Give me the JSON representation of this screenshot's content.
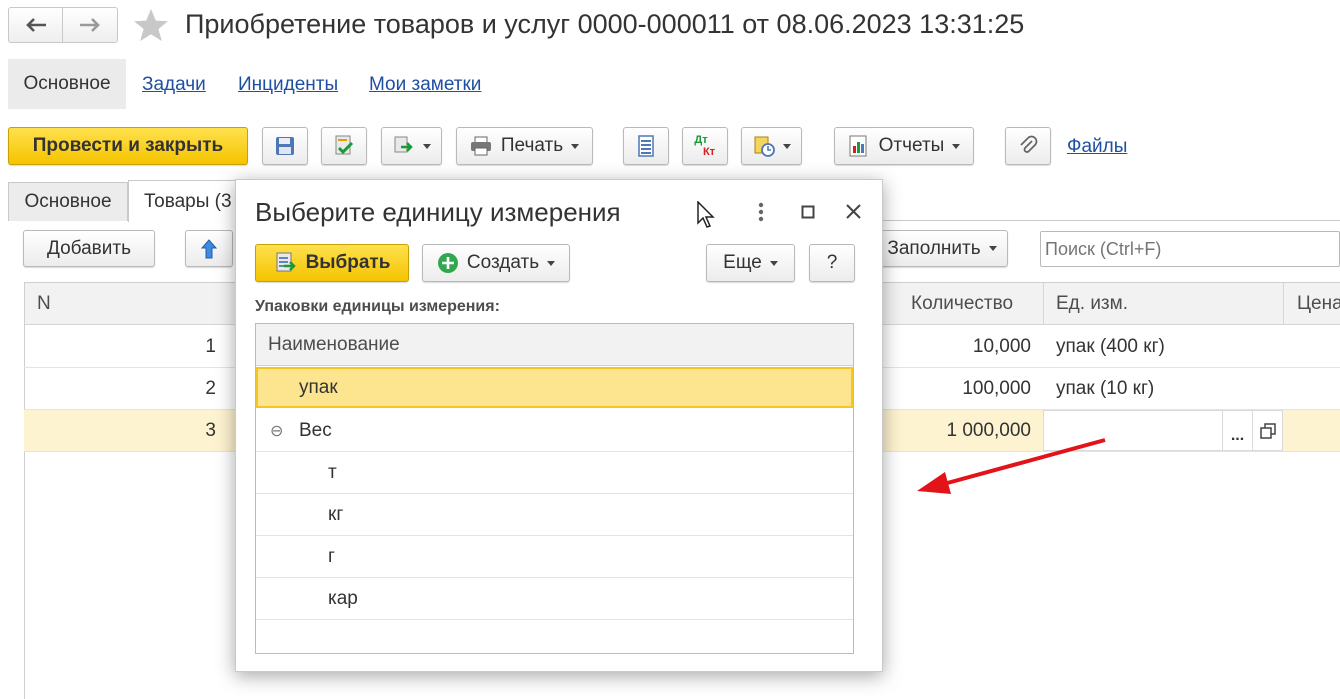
{
  "window": {
    "title": "Приобретение товаров и услуг 0000-000011 от 08.06.2023 13:31:25"
  },
  "nav_tabs": [
    {
      "label": "Основное"
    },
    {
      "label": "Задачи"
    },
    {
      "label": "Инциденты"
    },
    {
      "label": "Мои заметки"
    }
  ],
  "toolbar": {
    "post_close_label": "Провести и закрыть",
    "print_label": "Печать",
    "reports_label": "Отчеты",
    "files_label": "Файлы",
    "dt_label": "Дт",
    "kt_label": "Кт"
  },
  "doc_tabs": [
    {
      "label": "Основное"
    },
    {
      "label": "Товары (3"
    }
  ],
  "goods_toolbar": {
    "add_label": "Добавить",
    "fill_label": "Заполнить",
    "search_placeholder": "Поиск (Ctrl+F)"
  },
  "goods_table": {
    "columns": {
      "n": "N",
      "qty": "Количество",
      "unit": "Ед. изм.",
      "price": "Цена"
    },
    "rows": [
      {
        "n": "1",
        "qty": "10,000",
        "unit": "упак (400 кг)"
      },
      {
        "n": "2",
        "qty": "100,000",
        "unit": "упак (10 кг)"
      },
      {
        "n": "3",
        "qty": "1 000,000",
        "unit": ""
      }
    ],
    "ellipsis": "..."
  },
  "dialog": {
    "title": "Выберите единицу измерения",
    "select_label": "Выбрать",
    "create_label": "Создать",
    "more_label": "Еще",
    "help_label": "?",
    "section_label": "Упаковки единицы измерения:",
    "column_header": "Наименование",
    "items": [
      {
        "label": "упак"
      },
      {
        "label": "Вес",
        "expander": "⊖"
      },
      {
        "label": "т"
      },
      {
        "label": "кг"
      },
      {
        "label": "г"
      },
      {
        "label": "кар"
      }
    ]
  },
  "colors": {
    "accent_yellow": "#f5c400",
    "selected_row": "#fde58f",
    "current_row": "#fdf3d0",
    "link": "#1f4fa0",
    "annotation_arrow": "#e2141a"
  }
}
